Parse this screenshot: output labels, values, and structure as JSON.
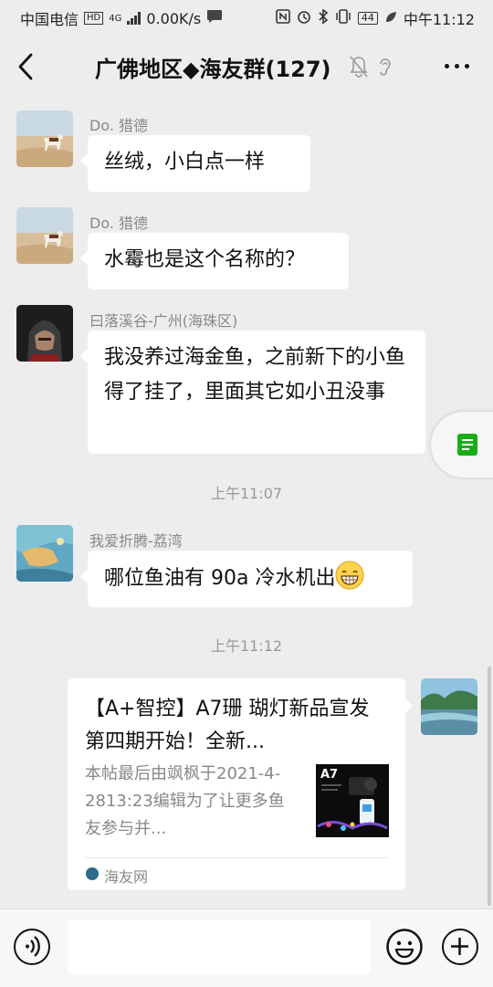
{
  "statusbar": {
    "carrier": "中国电信",
    "hd": "HD",
    "net": "4G",
    "speed": "0.00K/s",
    "battery": "44",
    "time": "中午11:12"
  },
  "header": {
    "title": "广佛地区◆海友群(127)"
  },
  "messages": [
    {
      "sender": "Do. 猎德",
      "text": "丝绒，小白点一样"
    },
    {
      "sender": "Do. 猎德",
      "text": "水霉也是这个名称的？"
    },
    {
      "sender": "曰落溪谷-广州(海珠区)",
      "text": "我没养过海金鱼，之前新下的小鱼得了挂了，里面其它如小丑没事"
    },
    {
      "sender": "我爱折腾-荔湾",
      "text": "哪位鱼油有 90a 冷水机出"
    }
  ],
  "timestamps": [
    "上午11:07",
    "上午11:12"
  ],
  "link_card": {
    "title": "【A+智控】A7珊 瑚灯新品宣发  第四期开始！全新...",
    "description": "本帖最后由飒枫于2021-4-2813:23编辑为了让更多鱼友参与并...",
    "thumb_label": "A7",
    "source": "海友网"
  },
  "colors": {
    "background": "#ededed",
    "bubble": "#ffffff",
    "doc_icon": "#1aad19"
  }
}
